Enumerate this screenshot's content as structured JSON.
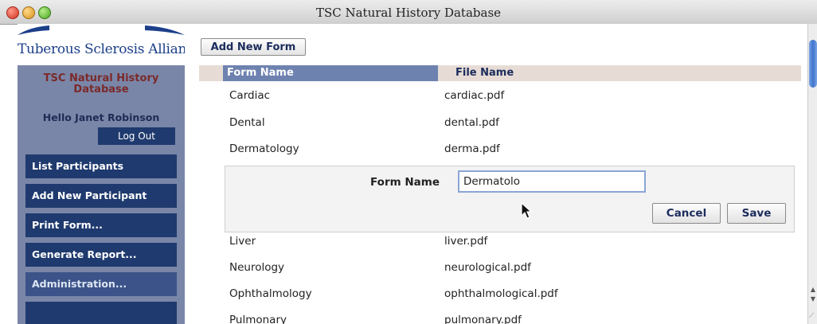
{
  "window": {
    "title": "TSC Natural History Database"
  },
  "sidebar": {
    "logo_text": "Tuberous Sclerosis Alliance",
    "db_title_line1": "TSC Natural History",
    "db_title_line2": "Database",
    "greeting": "Hello Janet Robinson",
    "logout_label": "Log Out",
    "nav": [
      {
        "label": "List Participants"
      },
      {
        "label": "Add New Participant"
      },
      {
        "label": "Print Form..."
      },
      {
        "label": "Generate Report..."
      },
      {
        "label": "Administration..."
      }
    ]
  },
  "main": {
    "add_form_label": "Add New Form",
    "columns": {
      "form_name": "Form Name",
      "file_name": "File Name"
    },
    "rows": [
      {
        "form": "Cardiac",
        "file": "cardiac.pdf"
      },
      {
        "form": "Dental",
        "file": "dental.pdf"
      },
      {
        "form": "Dermatology",
        "file": "derma.pdf"
      },
      {
        "form": "Liver",
        "file": "liver.pdf"
      },
      {
        "form": "Neurology",
        "file": "neurological.pdf"
      },
      {
        "form": "Ophthalmology",
        "file": "ophthalmological.pdf"
      },
      {
        "form": "Pulmonary",
        "file": "pulmonary.pdf"
      }
    ],
    "edit": {
      "label": "Form Name",
      "value": "Dermatolo",
      "cancel_label": "Cancel",
      "save_label": "Save"
    }
  },
  "colors": {
    "nav_button": "#1f3a6e",
    "side_panel": "#7a86a8",
    "header_highlight": "#6e82b0",
    "logo": "#1c3f8a"
  },
  "icons": {
    "window_controls": [
      "close-icon",
      "minimize-icon",
      "zoom-icon"
    ],
    "cursor": "mouse-pointer-icon"
  }
}
